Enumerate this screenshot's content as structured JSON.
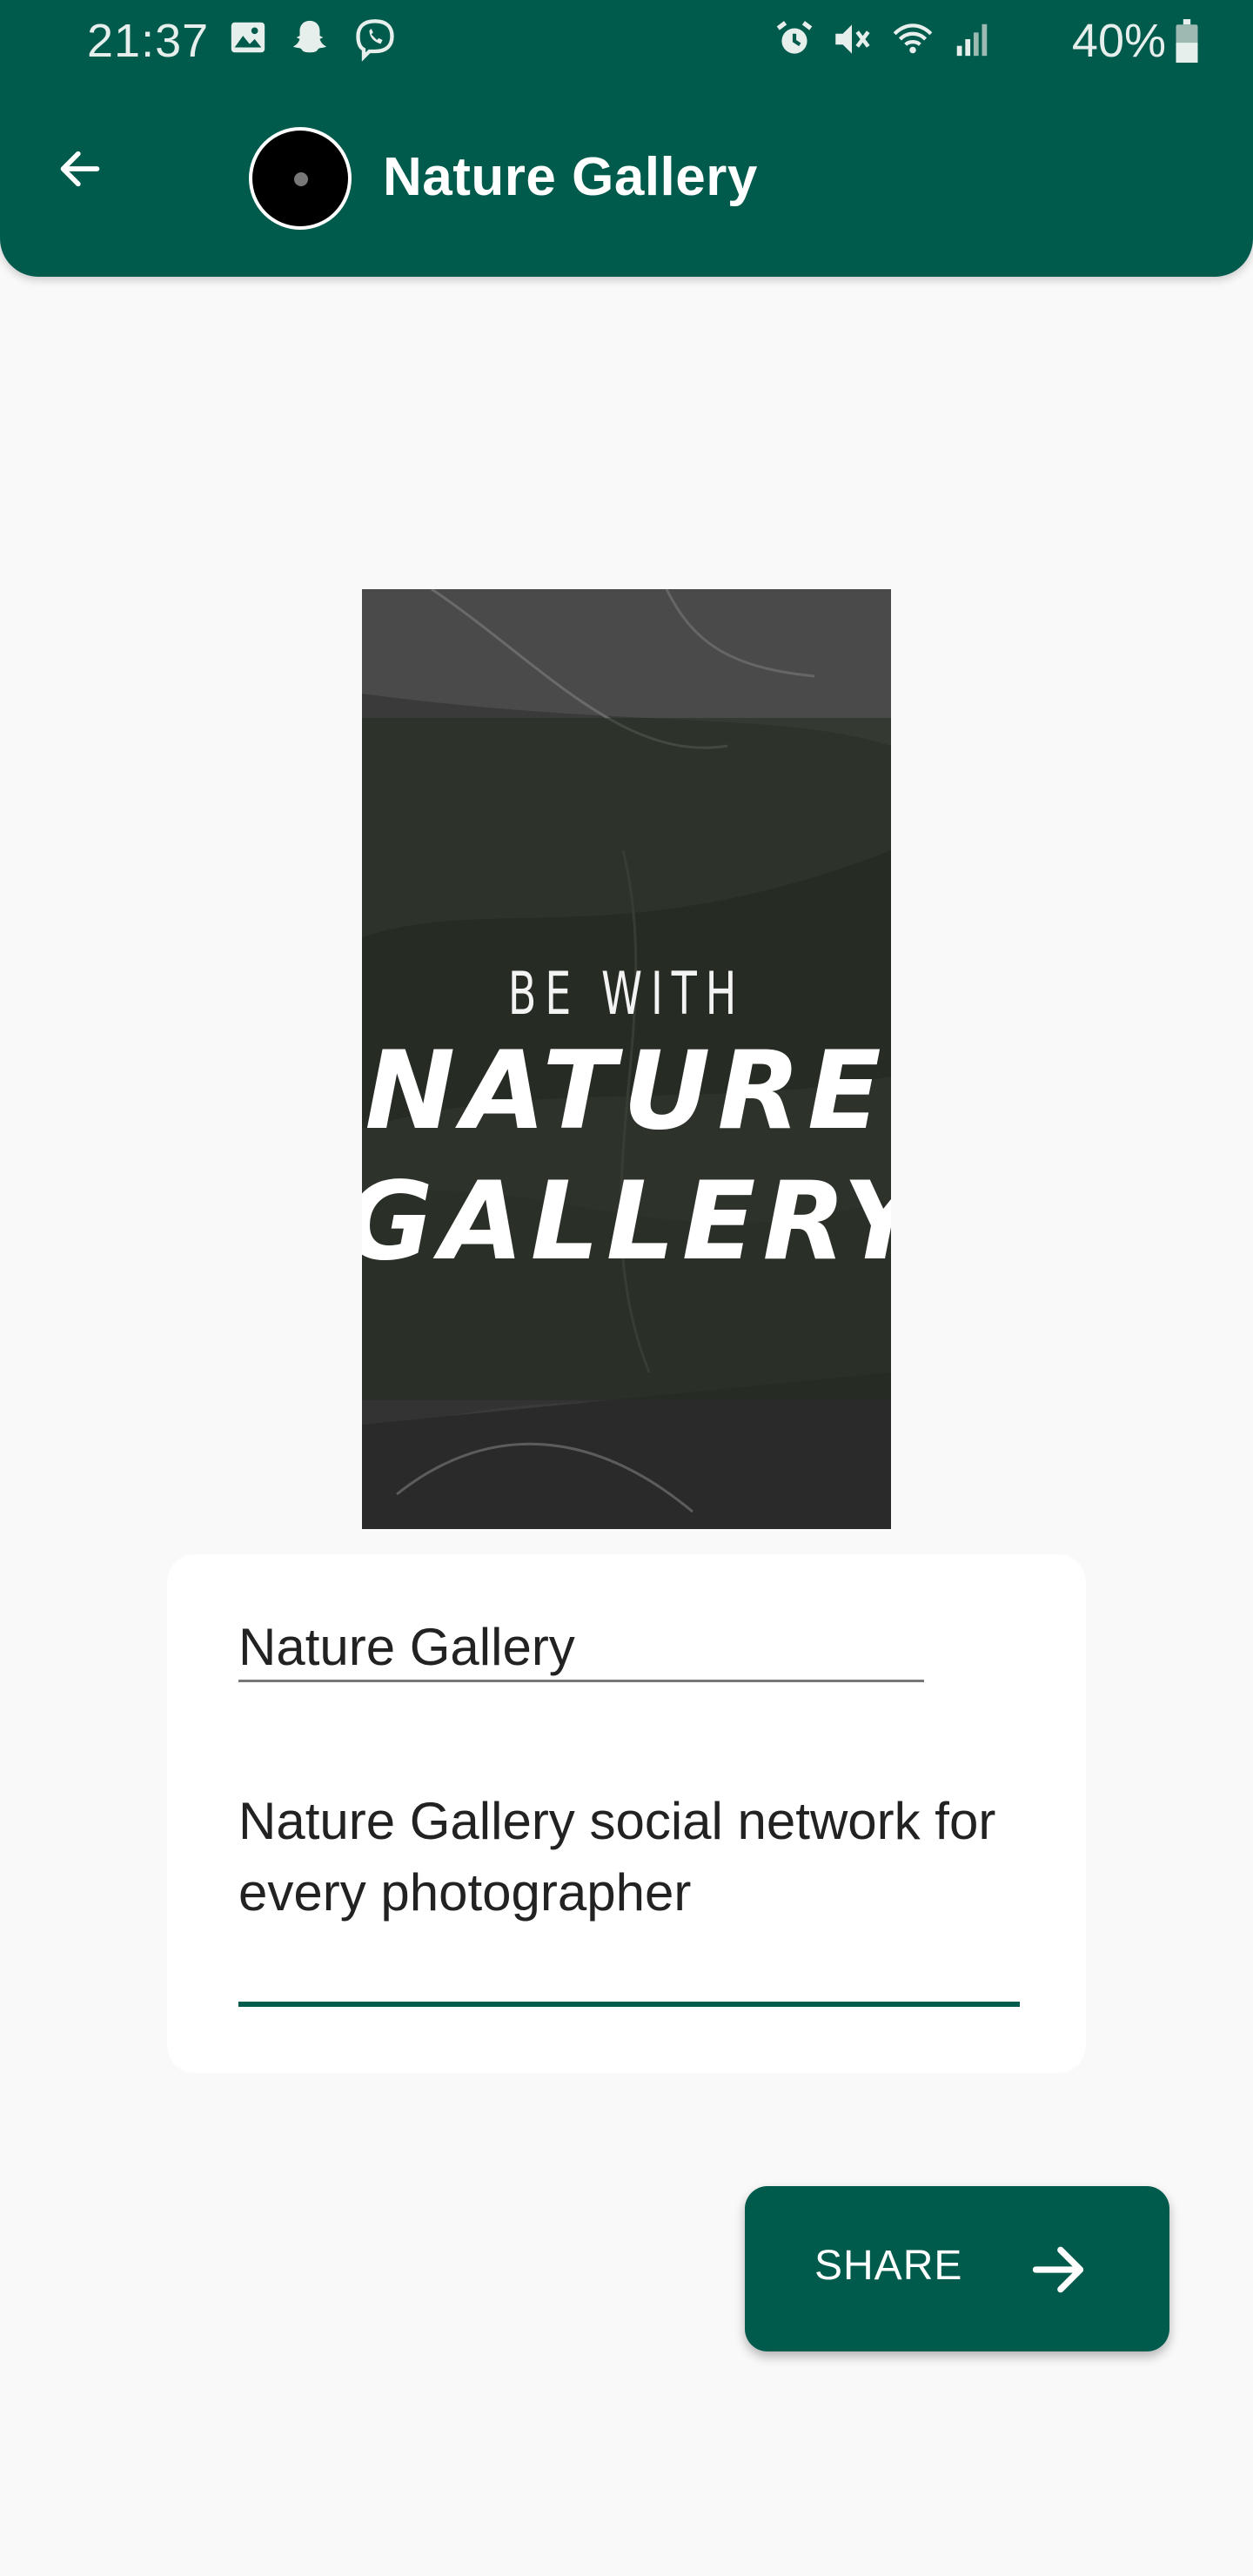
{
  "status_bar": {
    "time": "21:37",
    "battery_percent": "40%",
    "left_icons": [
      "gallery-icon",
      "snapchat-icon",
      "viber-icon"
    ],
    "right_icons": [
      "alarm-icon",
      "mute-icon",
      "wifi-icon",
      "signal-icon",
      "battery-icon"
    ]
  },
  "app_bar": {
    "title": "Nature Gallery",
    "back_icon": "arrow-left-icon",
    "color": "#005b4d"
  },
  "poster": {
    "line1": "BE WITH",
    "line2": "NATURE",
    "line3": "GALLERY"
  },
  "form": {
    "name_value": "Nature Gallery",
    "description_value": "Nature Gallery social network for every photographer"
  },
  "share_button": {
    "label": "SHARE",
    "icon": "arrow-right-icon"
  }
}
